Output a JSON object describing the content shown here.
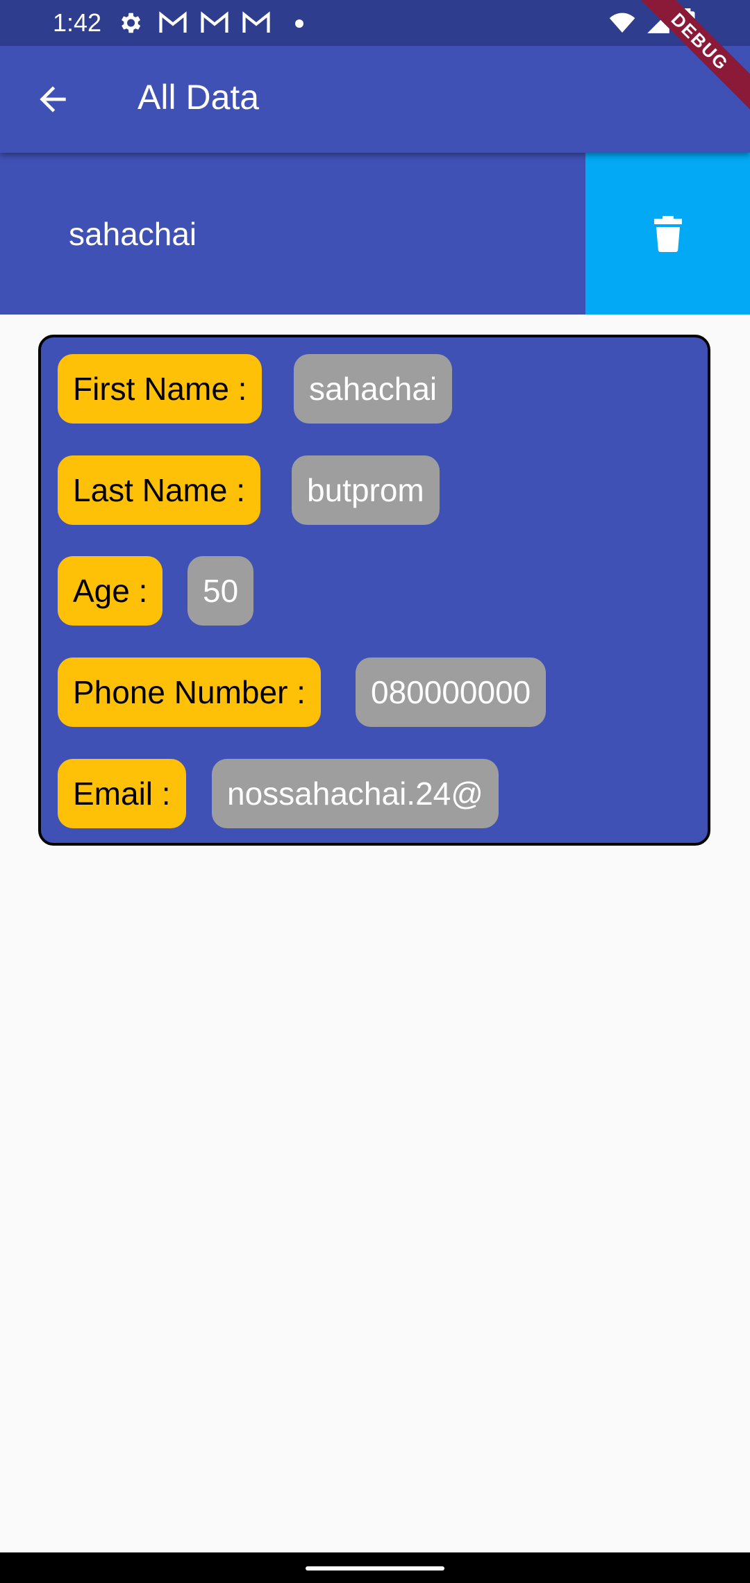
{
  "status_bar": {
    "time": "1:42",
    "left_icons": [
      "gear-icon",
      "gmail-icon",
      "gmail-icon",
      "gmail-icon",
      "dot-icon"
    ],
    "right_icons": [
      "wifi-icon",
      "signal-icon",
      "battery-icon"
    ]
  },
  "debug_banner": "DEBUG",
  "app_bar": {
    "title": "All Data",
    "back_icon": "arrow-back-icon"
  },
  "list": {
    "items": [
      {
        "name": "sahachai",
        "action_icon": "trash-icon"
      }
    ]
  },
  "detail": {
    "fields": [
      {
        "label": "First Name :",
        "value": "sahachai"
      },
      {
        "label": "Last Name :",
        "value": "butprom"
      },
      {
        "label": "Age :",
        "value": "50"
      },
      {
        "label": "Phone Number :",
        "value": "080000000"
      },
      {
        "label": "Email :",
        "value": "nossahachai.24@"
      }
    ]
  },
  "colors": {
    "primary": "#3F51B5",
    "status_bar": "#2F3D8F",
    "delete_background": "#03A9F4",
    "label_chip": "#FFC107",
    "value_chip": "#9E9E9E",
    "background": "#FAFAFA",
    "debug_banner": "#8B1A38"
  }
}
